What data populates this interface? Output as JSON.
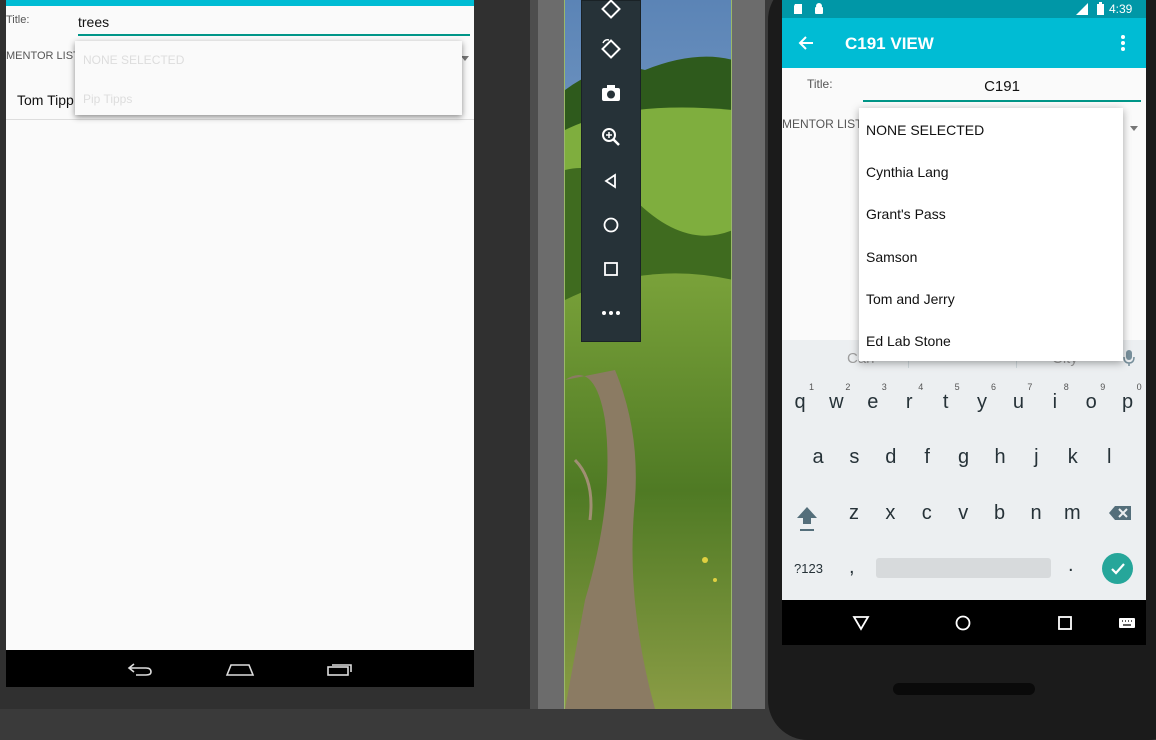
{
  "left_app": {
    "title_label": "Title:",
    "title_value": "trees",
    "mentor_label": "MENTOR LIST",
    "list_row": "Tom Tipp",
    "dropdown_items": [
      "NONE SELECTED",
      "Pip Tipps"
    ]
  },
  "right_app": {
    "status_time": "4:39",
    "toolbar_title": "C191 VIEW",
    "title_label": "Title:",
    "title_value": "C191",
    "mentor_label": "MENTOR LIST",
    "dropdown_items": [
      "NONE SELECTED",
      "Cynthia Lang",
      "Grant's Pass",
      "Samson",
      "Tom and Jerry",
      "Ed Lab Stone"
    ],
    "keyboard": {
      "suggestions": [
        "Can",
        "City"
      ],
      "row1": [
        "q",
        "w",
        "e",
        "r",
        "t",
        "y",
        "u",
        "i",
        "o",
        "p"
      ],
      "row1_numbers": [
        "1",
        "2",
        "3",
        "4",
        "5",
        "6",
        "7",
        "8",
        "9",
        "0"
      ],
      "row2": [
        "a",
        "s",
        "d",
        "f",
        "g",
        "h",
        "j",
        "k",
        "l"
      ],
      "row3": [
        "z",
        "x",
        "c",
        "v",
        "b",
        "n",
        "m"
      ],
      "symbols_label": "?123",
      "comma": ",",
      "period": "."
    }
  },
  "icons": {
    "left_nav": [
      "back-icon",
      "home-icon",
      "recents-icon"
    ],
    "emulator_toolbar": [
      "rotate-left-icon",
      "rotate-right-icon",
      "camera-icon",
      "zoom-icon",
      "back-icon",
      "home-icon",
      "overview-icon",
      "more-icon"
    ],
    "right_nav": [
      "back-icon",
      "home-icon",
      "recents-icon",
      "keyboard-icon"
    ]
  },
  "colors": {
    "accent": "#00bcd4",
    "accent_dark": "#0097a7",
    "underline": "#009688",
    "check": "#26a69a"
  }
}
